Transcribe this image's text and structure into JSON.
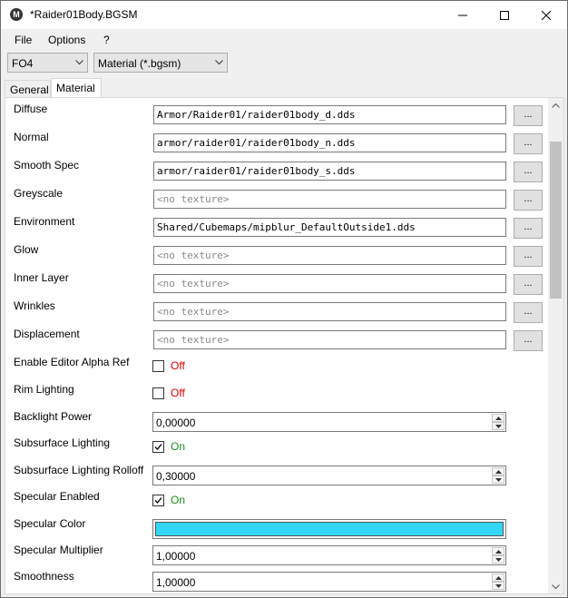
{
  "window": {
    "title": "*Raider01Body.BGSM",
    "icon_letter": "M"
  },
  "menu": [
    "File",
    "Options",
    "?"
  ],
  "toolbar": {
    "game_select": "FO4",
    "type_select": "Material (*.bgsm)"
  },
  "tabs": [
    {
      "label": "General",
      "active": false
    },
    {
      "label": "Material",
      "active": true
    }
  ],
  "textures": [
    {
      "label": "Diffuse",
      "value": "Armor/Raider01/raider01body_d.dds",
      "empty": false
    },
    {
      "label": "Normal",
      "value": "armor/raider01/raider01body_n.dds",
      "empty": false
    },
    {
      "label": "Smooth Spec",
      "value": "armor/raider01/raider01body_s.dds",
      "empty": false
    },
    {
      "label": "Greyscale",
      "value": "<no texture>",
      "empty": true
    },
    {
      "label": "Environment",
      "value": "Shared/Cubemaps/mipblur_DefaultOutside1.dds",
      "empty": false
    },
    {
      "label": "Glow",
      "value": "<no texture>",
      "empty": true
    },
    {
      "label": "Inner Layer",
      "value": "<no texture>",
      "empty": true
    },
    {
      "label": "Wrinkles",
      "value": "<no texture>",
      "empty": true
    },
    {
      "label": "Displacement",
      "value": "<no texture>",
      "empty": true
    }
  ],
  "browse_label": "...",
  "properties": {
    "editor_alpha_ref": {
      "label": "Enable Editor Alpha Ref",
      "checked": false,
      "state": "Off"
    },
    "rim_lighting": {
      "label": "Rim Lighting",
      "checked": false,
      "state": "Off"
    },
    "backlight_power": {
      "label": "Backlight Power",
      "value": "0,00000"
    },
    "subsurface_lighting": {
      "label": "Subsurface Lighting",
      "checked": true,
      "state": "On"
    },
    "subsurface_rolloff": {
      "label": "Subsurface Lighting Rolloff",
      "value": "0,30000"
    },
    "specular_enabled": {
      "label": "Specular Enabled",
      "checked": true,
      "state": "On"
    },
    "specular_color": {
      "label": "Specular Color",
      "color": "#33d6f5"
    },
    "specular_multiplier": {
      "label": "Specular Multiplier",
      "value": "1,00000"
    },
    "smoothness": {
      "label": "Smoothness",
      "value": "1,00000"
    }
  }
}
